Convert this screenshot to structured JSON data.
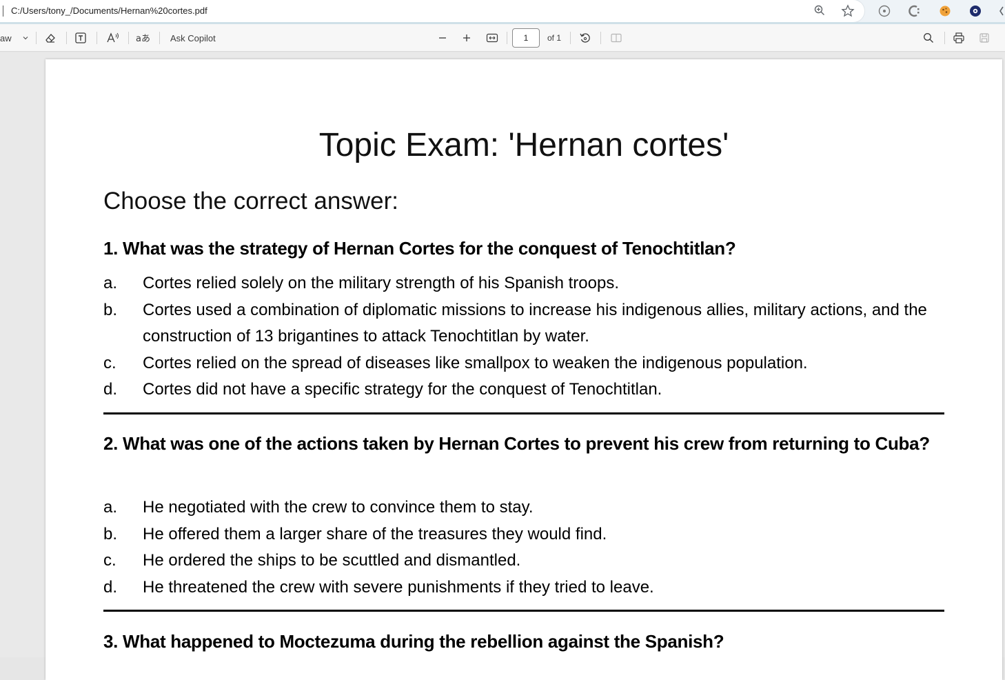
{
  "address_bar": {
    "url": "C:/Users/tony_/Documents/Hernan%20cortes.pdf"
  },
  "toolbar": {
    "draw_label": "aw",
    "ask_copilot": "Ask Copilot",
    "page_number": "1",
    "page_total": "of 1"
  },
  "document": {
    "title": "Topic Exam: 'Hernan cortes'",
    "instruction": "Choose the correct answer:",
    "questions": [
      {
        "text": "1. What was the strategy of Hernan Cortes for the conquest of Tenochtitlan?",
        "options": [
          {
            "letter": "a.",
            "text": "Cortes relied solely on the military strength of his Spanish troops."
          },
          {
            "letter": "b.",
            "text": "Cortes used a combination of diplomatic missions to increase his indigenous allies, military actions, and the construction of 13 brigantines to attack Tenochtitlan by water."
          },
          {
            "letter": "c.",
            "text": "Cortes relied on the spread of diseases like smallpox to weaken the indigenous population."
          },
          {
            "letter": "d.",
            "text": "Cortes did not have a specific strategy for the conquest of Tenochtitlan."
          }
        ]
      },
      {
        "text": "2. What was one of the actions taken by Hernan Cortes to prevent his crew from returning to Cuba?",
        "options": [
          {
            "letter": "a.",
            "text": "He negotiated with the crew to convince them to stay."
          },
          {
            "letter": "b.",
            "text": "He offered them a larger share of the treasures they would find."
          },
          {
            "letter": "c.",
            "text": "He ordered the ships to be scuttled and dismantled."
          },
          {
            "letter": "d.",
            "text": "He threatened the crew with severe punishments if they tried to leave."
          }
        ]
      },
      {
        "text": "3. What happened to Moctezuma during the rebellion against the Spanish?",
        "options": []
      }
    ]
  }
}
